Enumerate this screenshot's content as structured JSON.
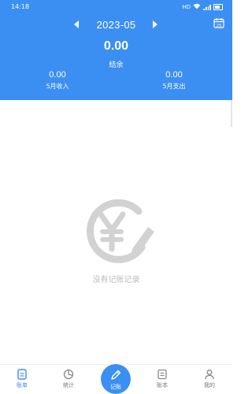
{
  "status_bar": {
    "time": "14:18",
    "network_label": "HD"
  },
  "header": {
    "month": "2023-05",
    "balance_value": "0.00",
    "balance_label": "结余",
    "income": {
      "value": "0.00",
      "label": "5月收入"
    },
    "expense": {
      "value": "0.00",
      "label": "5月支出"
    },
    "calendar_icon_day": "25"
  },
  "empty_state": {
    "message": "没有记账记录",
    "icon": "yen-pencil-icon"
  },
  "bottom_nav": {
    "items": [
      {
        "label": "账单",
        "icon": "bill-icon",
        "active": true
      },
      {
        "label": "统计",
        "icon": "chart-icon",
        "active": false
      },
      {
        "label": "账本",
        "icon": "ledger-icon",
        "active": false
      },
      {
        "label": "我的",
        "icon": "user-icon",
        "active": false
      }
    ],
    "fab_label": "记账",
    "fab_icon": "pencil-icon"
  },
  "colors": {
    "primary": "#3c8ff2",
    "empty_gray": "#bcbcbc",
    "nav_inactive": "#777777"
  }
}
